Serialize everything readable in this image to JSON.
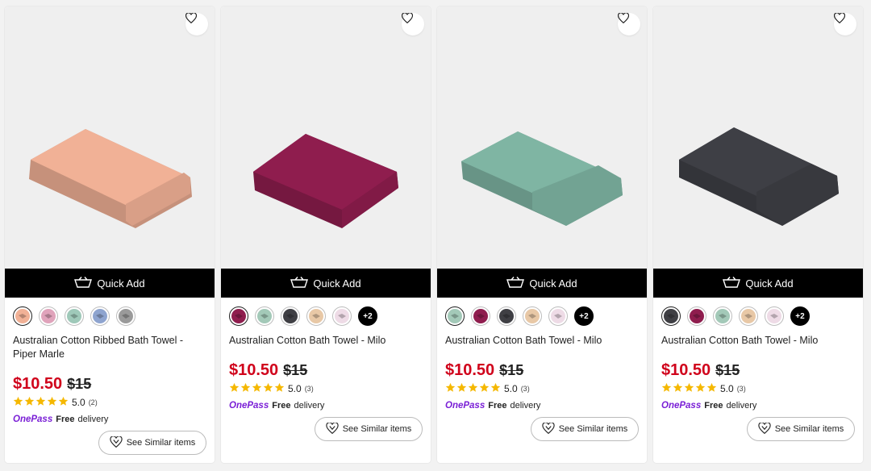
{
  "products": [
    {
      "title": "Australian Cotton Ribbed Bath Towel - Piper Marle",
      "price": "$10.50",
      "was_price": "$15",
      "rating": "5.0",
      "review_count": "(2)",
      "quick_add_label": "Quick Add",
      "onepass_label": "OnePass",
      "free_label": "Free",
      "delivery_label": "delivery",
      "similar_label": "See Similar items",
      "towel_color": "#f1b196",
      "swatches": [
        "#f1b196",
        "#e0a3bb",
        "#9fc9b9",
        "#8ea4cf",
        "#9a9a9a"
      ],
      "more_label": ""
    },
    {
      "title": "Australian Cotton Bath Towel - Milo",
      "price": "$10.50",
      "was_price": "$15",
      "rating": "5.0",
      "review_count": "(3)",
      "quick_add_label": "Quick Add",
      "onepass_label": "OnePass",
      "free_label": "Free",
      "delivery_label": "delivery",
      "similar_label": "See Similar items",
      "towel_color": "#8f1d4e",
      "swatches": [
        "#8f1d4e",
        "#a3c9b8",
        "#3f3f44",
        "#e8c8a6",
        "#eedbe6"
      ],
      "more_label": "+2"
    },
    {
      "title": "Australian Cotton Bath Towel - Milo",
      "price": "$10.50",
      "was_price": "$15",
      "rating": "5.0",
      "review_count": "(3)",
      "quick_add_label": "Quick Add",
      "onepass_label": "OnePass",
      "free_label": "Free",
      "delivery_label": "delivery",
      "similar_label": "See Similar items",
      "towel_color": "#7fb5a3",
      "swatches": [
        "#a3c9b8",
        "#8f1d4e",
        "#3f3f44",
        "#e8c8a6",
        "#eedbe6"
      ],
      "more_label": "+2"
    },
    {
      "title": "Australian Cotton Bath Towel - Milo",
      "price": "$10.50",
      "was_price": "$15",
      "rating": "5.0",
      "review_count": "(3)",
      "quick_add_label": "Quick Add",
      "onepass_label": "OnePass",
      "free_label": "Free",
      "delivery_label": "delivery",
      "similar_label": "See Similar items",
      "towel_color": "#3e3f45",
      "swatches": [
        "#3f3f44",
        "#8f1d4e",
        "#a3c9b8",
        "#e8c8a6",
        "#eedbe6"
      ],
      "more_label": "+2"
    }
  ],
  "colors": {
    "price_red": "#d0021b",
    "onepass_purple": "#7a1fd6",
    "star_gold": "#f5b800"
  },
  "icons": {
    "wishlist": "heart-icon",
    "cart": "basket-icon",
    "similar": "similar-heart-icon",
    "star": "star-icon"
  }
}
